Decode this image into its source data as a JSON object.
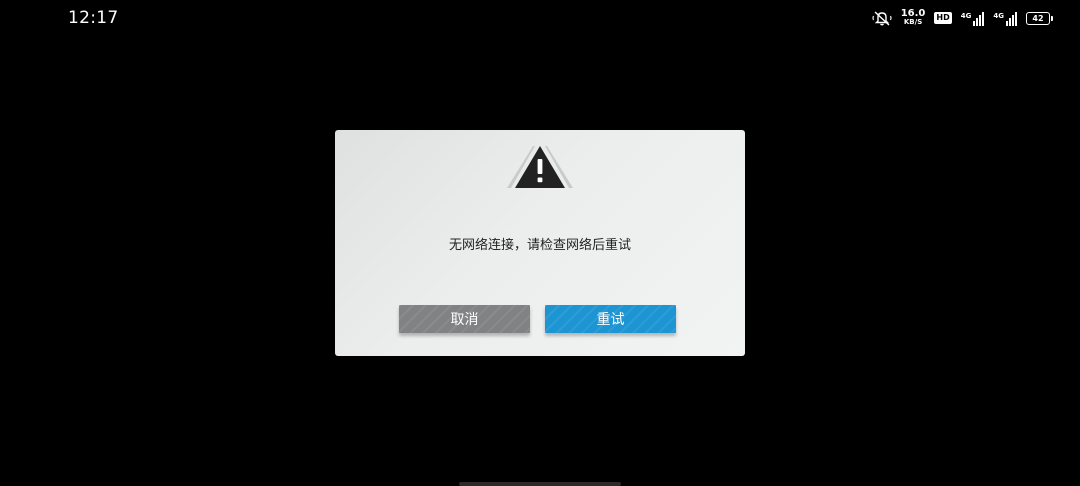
{
  "status_bar": {
    "time": "12:17",
    "icons": {
      "mute": "bell-off-icon",
      "network_speed_value": "16.0",
      "network_speed_unit": "KB/S",
      "hd_label": "HD",
      "signal1_label": "4G",
      "signal2_label": "4G",
      "battery_level": "42"
    }
  },
  "dialog": {
    "icon": "warning-triangle-icon",
    "icon_color": "#222222",
    "message": "无网络连接，请检查网络后重试",
    "cancel_label": "取消",
    "retry_label": "重试",
    "cancel_color": "#808284",
    "retry_color": "#1e95d3"
  },
  "colors": {
    "background": "#000000",
    "dialog_background": "#eceeee"
  }
}
